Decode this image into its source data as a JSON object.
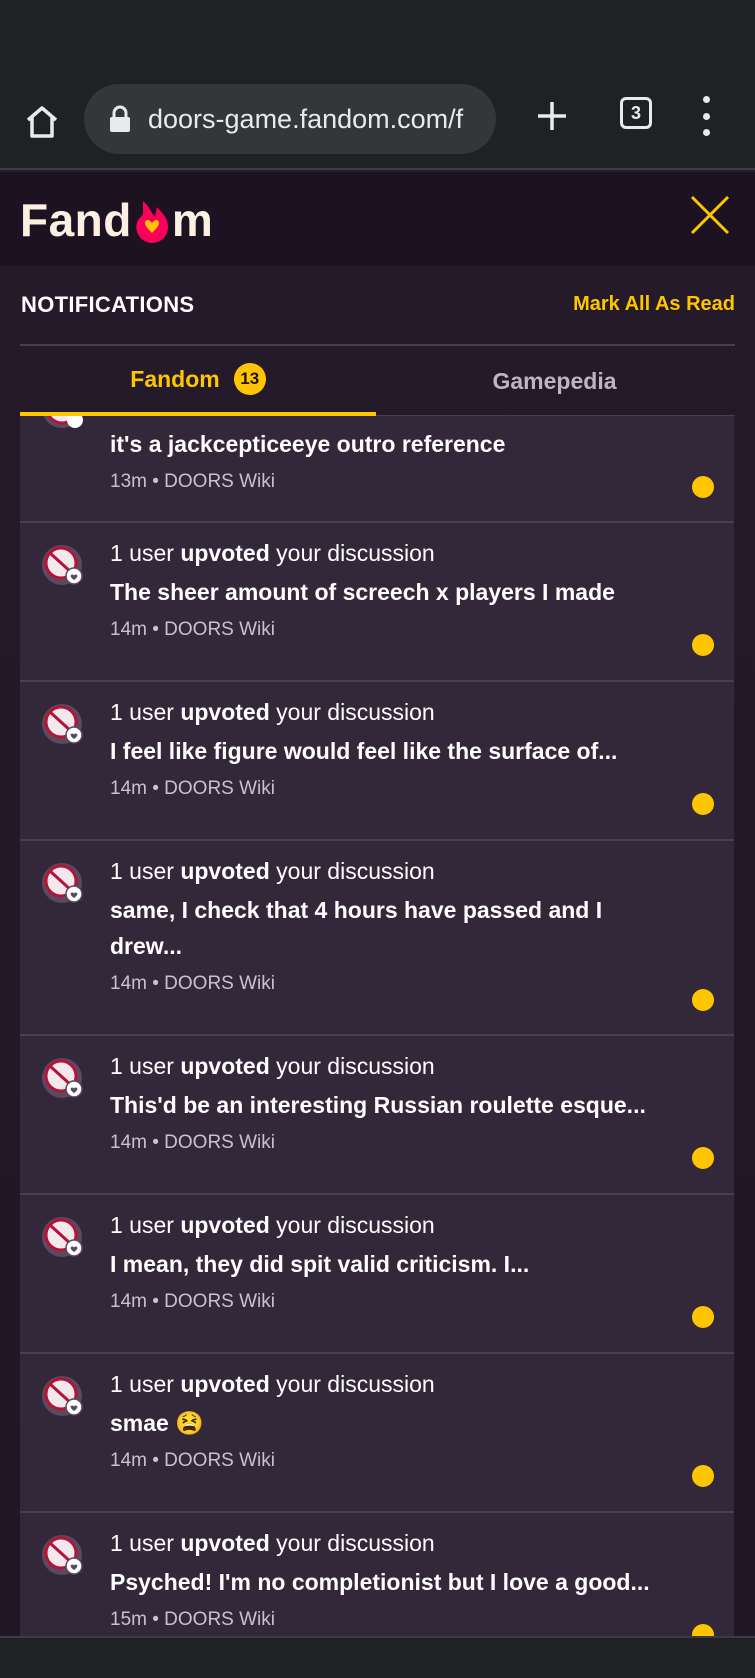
{
  "browser": {
    "url": "doors-game.fandom.com/f",
    "tab_count": "3"
  },
  "app": {
    "logo_text_left": "Fand",
    "logo_text_right": "m",
    "notifications_title": "NOTIFICATIONS",
    "mark_all_label": "Mark All As Read",
    "tabs": [
      {
        "label": "Fandom",
        "badge": "13"
      },
      {
        "label": "Gamepedia"
      }
    ],
    "accent_color": "#ffc500"
  },
  "notifications": [
    {
      "action_prefix": "",
      "action_bold": "",
      "action_suffix": "",
      "title": "it's a jackcepticeeye outro reference",
      "meta": "13m • DOORS Wiki",
      "partial": true
    },
    {
      "action_prefix": "1 user ",
      "action_bold": "upvoted",
      "action_suffix": " your discussion",
      "title": "The sheer amount of screech x players I made",
      "meta": "14m • DOORS Wiki"
    },
    {
      "action_prefix": "1 user ",
      "action_bold": "upvoted",
      "action_suffix": " your discussion",
      "title": "I feel like figure would feel like the surface of...",
      "meta": "14m • DOORS Wiki"
    },
    {
      "action_prefix": "1 user ",
      "action_bold": "upvoted",
      "action_suffix": " your discussion",
      "title": "same, I check that 4 hours have passed and I drew...",
      "meta": "14m • DOORS Wiki"
    },
    {
      "action_prefix": "1 user ",
      "action_bold": "upvoted",
      "action_suffix": " your discussion",
      "title": "This'd be an interesting Russian roulette esque...",
      "meta": "14m • DOORS Wiki"
    },
    {
      "action_prefix": "1 user ",
      "action_bold": "upvoted",
      "action_suffix": " your discussion",
      "title": "I mean, they did spit valid criticism. I...",
      "meta": "14m • DOORS Wiki"
    },
    {
      "action_prefix": "1 user ",
      "action_bold": "upvoted",
      "action_suffix": " your discussion",
      "title": "smae 😫",
      "meta": "14m • DOORS Wiki"
    },
    {
      "action_prefix": "1 user ",
      "action_bold": "upvoted",
      "action_suffix": " your discussion",
      "title": "Psyched! I'm no completionist but I love a good...",
      "meta": "15m • DOORS Wiki"
    }
  ]
}
